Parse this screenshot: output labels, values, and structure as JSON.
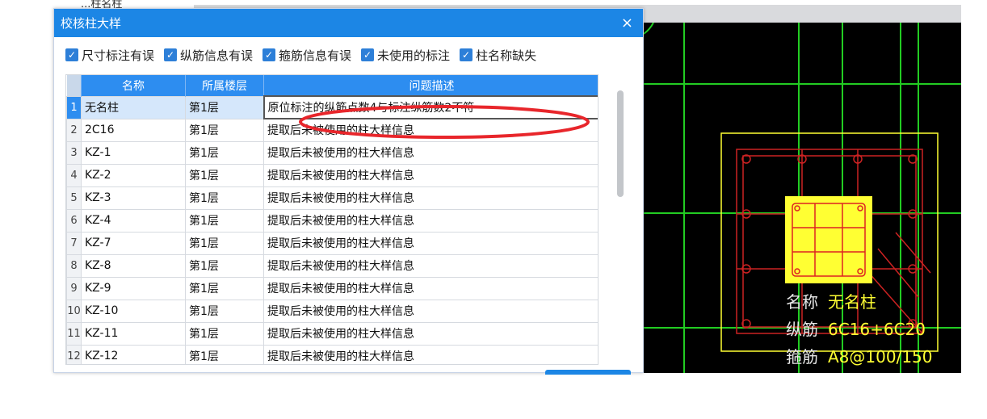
{
  "background": {
    "hidden_title": "...柱名柱"
  },
  "dialog": {
    "title": "校核柱大样",
    "close_label": "×",
    "filters": [
      {
        "label": "尺寸标注有误",
        "checked": true
      },
      {
        "label": "纵筋信息有误",
        "checked": true
      },
      {
        "label": "箍筋信息有误",
        "checked": true
      },
      {
        "label": "未使用的标注",
        "checked": true
      },
      {
        "label": "柱名称缺失",
        "checked": true
      }
    ],
    "table": {
      "headers": [
        "名称",
        "所属楼层",
        "问题描述"
      ],
      "rows": [
        {
          "idx": "1",
          "name": "无名柱",
          "floor": "第1层",
          "desc": "原位标注的纵筋点数4与标注纵筋数2不符"
        },
        {
          "idx": "2",
          "name": "2C16",
          "floor": "第1层",
          "desc": "提取后未被使用的柱大样信息"
        },
        {
          "idx": "3",
          "name": "KZ-1",
          "floor": "第1层",
          "desc": "提取后未被使用的柱大样信息"
        },
        {
          "idx": "4",
          "name": "KZ-2",
          "floor": "第1层",
          "desc": "提取后未被使用的柱大样信息"
        },
        {
          "idx": "5",
          "name": "KZ-3",
          "floor": "第1层",
          "desc": "提取后未被使用的柱大样信息"
        },
        {
          "idx": "6",
          "name": "KZ-4",
          "floor": "第1层",
          "desc": "提取后未被使用的柱大样信息"
        },
        {
          "idx": "7",
          "name": "KZ-7",
          "floor": "第1层",
          "desc": "提取后未被使用的柱大样信息"
        },
        {
          "idx": "8",
          "name": "KZ-8",
          "floor": "第1层",
          "desc": "提取后未被使用的柱大样信息"
        },
        {
          "idx": "9",
          "name": "KZ-9",
          "floor": "第1层",
          "desc": "提取后未被使用的柱大样信息"
        },
        {
          "idx": "10",
          "name": "KZ-10",
          "floor": "第1层",
          "desc": "提取后未被使用的柱大样信息"
        },
        {
          "idx": "11",
          "name": "KZ-11",
          "floor": "第1层",
          "desc": "提取后未被使用的柱大样信息"
        },
        {
          "idx": "12",
          "name": "KZ-12",
          "floor": "第1层",
          "desc": "提取后未被使用的柱大样信息"
        }
      ]
    }
  },
  "cad": {
    "labels": [
      {
        "key": "名称",
        "value": "无名柱"
      },
      {
        "key": "纵筋",
        "value": "6C16+6C20"
      },
      {
        "key": "箍筋",
        "value": "A8@100/150"
      }
    ]
  },
  "colors": {
    "accent": "#1c86e5",
    "annotation": "#e8262b",
    "cad_green": "#22cc22",
    "cad_yellow": "#ffff33",
    "cad_red": "#cc2222"
  }
}
